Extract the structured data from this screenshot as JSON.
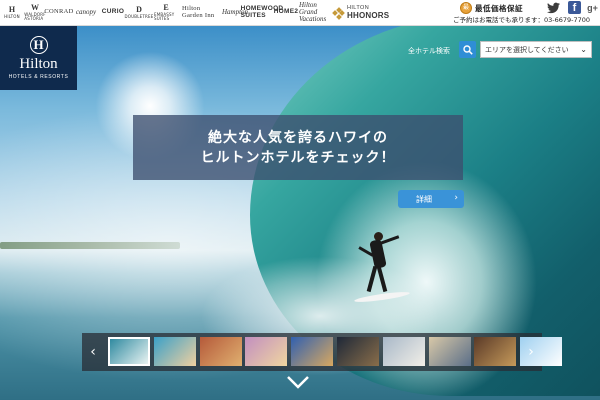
{
  "brands": {
    "items": [
      {
        "id": "hilton",
        "glyph": "H",
        "sub": "Hilton"
      },
      {
        "id": "waldorf",
        "glyph": "W",
        "sub": "WALDORF ASTORIA"
      },
      {
        "id": "conrad",
        "word": "CONRAD"
      },
      {
        "id": "canopy",
        "script": "canopy"
      },
      {
        "id": "curio",
        "sans": "CURIO"
      },
      {
        "id": "doubletree",
        "glyph": "D",
        "sub": "DOUBLETREE"
      },
      {
        "id": "embassy",
        "glyph": "E",
        "sub": "EMBASSY SUITES"
      },
      {
        "id": "gardeninn",
        "word": "Hilton Garden Inn"
      },
      {
        "id": "hampton",
        "script": "Hampton"
      },
      {
        "id": "homewood",
        "sans": "HOMEWOOD SUITES"
      },
      {
        "id": "home2",
        "sans": "HOME2"
      },
      {
        "id": "grandvacations",
        "script": "Hilton Grand Vacations"
      }
    ],
    "hhonors_line1": "HILTON",
    "hhonors_line2": "HHONORS"
  },
  "header": {
    "best_price_medal": "最",
    "best_price": "最低価格保証",
    "phone": "ご予約はお電話でも承ります：03-6679-7700"
  },
  "logo": {
    "mark": "H",
    "name": "Hilton",
    "sub": "HOTELS & RESORTS"
  },
  "search": {
    "label": "全ホテル検索",
    "select_placeholder": "エリアを選択してください"
  },
  "banner": {
    "line1": "絶大な人気を誇るハワイの",
    "line2": "ヒルトンホテルをチェック！"
  },
  "detail_button": {
    "label": "詳細",
    "chevron": "›"
  },
  "carousel": {
    "prev": "‹",
    "next": "›",
    "thumbnails": [
      {
        "name": "surf",
        "colors": [
          "#2f8aa0",
          "#e8f3f2"
        ],
        "active": true
      },
      {
        "name": "pool",
        "colors": [
          "#3aa0c8",
          "#f0d0a0"
        ],
        "active": false
      },
      {
        "name": "hotel-room",
        "colors": [
          "#b55a3a",
          "#e0b070"
        ],
        "active": false
      },
      {
        "name": "sunset-resort",
        "colors": [
          "#c28fc0",
          "#f0d6a0"
        ],
        "active": false
      },
      {
        "name": "tower-bridge",
        "colors": [
          "#3060b0",
          "#d8a860"
        ],
        "active": false
      },
      {
        "name": "city-night",
        "colors": [
          "#1e2838",
          "#8a6e4a"
        ],
        "active": false
      },
      {
        "name": "couple",
        "colors": [
          "#a8b8c8",
          "#f2efe8"
        ],
        "active": false
      },
      {
        "name": "business",
        "colors": [
          "#d8c8a8",
          "#5a6e88"
        ],
        "active": false
      },
      {
        "name": "lobby",
        "colors": [
          "#5a3a28",
          "#c69a5a"
        ],
        "active": false
      },
      {
        "name": "beach-wedding",
        "colors": [
          "#9fd0f0",
          "#ffffff"
        ],
        "active": false
      }
    ]
  }
}
